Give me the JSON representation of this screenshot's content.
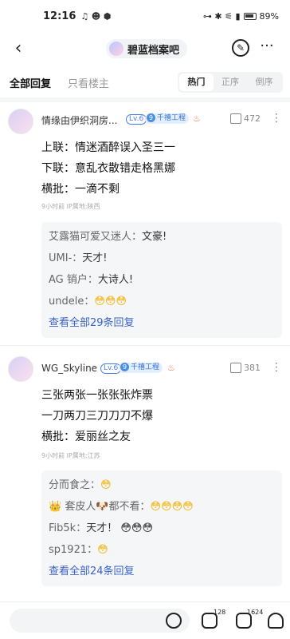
{
  "status": {
    "time": "12:16",
    "left_icons": "♫ ☻ ⬢",
    "right_icons": "⊶ ✱ ⚟ ▮",
    "battery": "89%"
  },
  "header": {
    "forum_name": "碧蓝档案吧"
  },
  "tabs": {
    "all": "全部回复",
    "owner_only": "只看楼主",
    "sort": [
      "热门",
      "正序",
      "倒序"
    ]
  },
  "posts": [
    {
      "username": "情缘由伊织洞房...",
      "level": "Lv.6",
      "badge_num": "9",
      "badge": "千禧工程",
      "likes": "472",
      "lines": [
        "上联：情迷酒醉误入圣三一",
        "下联：意乱衣散错走格黑娜",
        "横批：一滴不剩"
      ],
      "meta": "9小时前  IP属地:陕西",
      "replies": [
        {
          "who": "艾露猫可爱又迷人：",
          "text": "文豪!"
        },
        {
          "who": "UMI-：",
          "text": "天才!"
        },
        {
          "who": "AG 销户：",
          "text": "大诗人!"
        },
        {
          "who": "undele：",
          "text": "😳😳😳"
        }
      ],
      "view_all": "查看全部29条回复"
    },
    {
      "username": "WG_Skyline",
      "level": "Lv.6",
      "badge_num": "9",
      "badge": "千禧工程",
      "likes": "381",
      "lines": [
        "三张两张一张张张炸票",
        "一刀两刀三刀刀刀不爆",
        "横批：爱丽丝之友"
      ],
      "meta": "9小时前  IP属地:江苏",
      "replies": [
        {
          "who": "分而食之：",
          "text": "😳"
        },
        {
          "who": "👑 套皮人🐶都不看：",
          "text": "😳😳😳😳"
        },
        {
          "who": "Fib5k：",
          "text": "天才！ 😳😳😳"
        },
        {
          "who": "sp1921：",
          "text": "😳"
        }
      ],
      "view_all": "查看全部24条回复"
    }
  ],
  "bottom": {
    "comments": "128",
    "likes": "1624"
  }
}
